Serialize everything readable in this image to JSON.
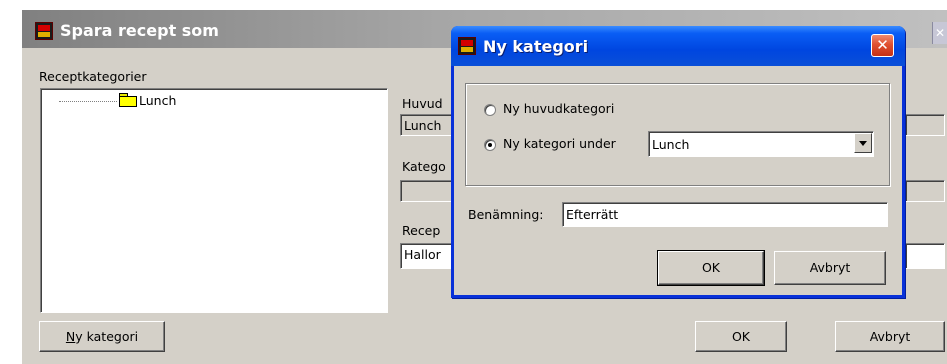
{
  "back_window": {
    "title": "Spara recept som",
    "close_glyph": "✕",
    "receptkategorier_label": "Receptkategorier",
    "tree": [
      {
        "label": "Lunch",
        "icon": "folder-icon"
      }
    ],
    "huvudkategori_label": "Huvud",
    "huvudkategori_value": "Lunch",
    "kategori_label": "Katego",
    "kategori_value": "",
    "recept_label": "Recep",
    "recept_value": "Hallor",
    "ny_kategori_button": {
      "mnemonic": "N",
      "rest": "y kategori"
    },
    "ok_button": "OK",
    "avbryt_button": "Avbryt"
  },
  "dialog": {
    "title": "Ny kategori",
    "close_glyph": "✕",
    "radio_options": [
      {
        "label": "Ny huvudkategori",
        "checked": false
      },
      {
        "label": "Ny kategori under",
        "checked": true
      }
    ],
    "combo_value": "Lunch",
    "benamning_label": "Benämning:",
    "benamning_value": "Efterrätt",
    "ok_button": "OK",
    "avbryt_button": "Avbryt"
  },
  "colors": {
    "xp_title_blue": "#0a5ef5",
    "inactive_title": "#a6a6a6",
    "dialog_face": "#d4d0c8",
    "close_red": "#e05030",
    "folder_yellow": "#ffff00"
  }
}
